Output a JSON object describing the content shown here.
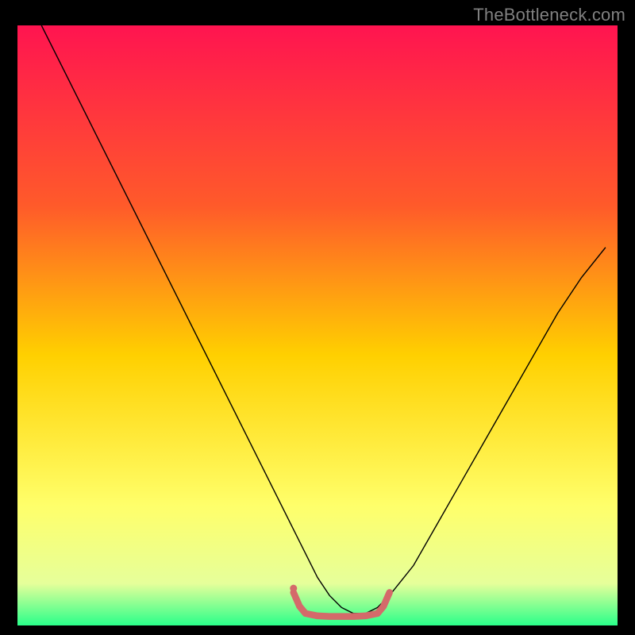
{
  "watermark": "TheBottleneck.com",
  "chart_data": {
    "type": "line",
    "title": "",
    "xlabel": "",
    "ylabel": "",
    "xlim": [
      0,
      100
    ],
    "ylim": [
      0,
      100
    ],
    "background_gradient": {
      "stops": [
        {
          "offset": 0.0,
          "color": "#ff1450"
        },
        {
          "offset": 0.3,
          "color": "#ff5a2a"
        },
        {
          "offset": 0.55,
          "color": "#ffd000"
        },
        {
          "offset": 0.8,
          "color": "#ffff6a"
        },
        {
          "offset": 0.93,
          "color": "#e6ff9a"
        },
        {
          "offset": 1.0,
          "color": "#2aff8a"
        }
      ]
    },
    "series": [
      {
        "name": "bottleneck-curve",
        "color": "#000000",
        "width": 1.4,
        "x": [
          4,
          8,
          12,
          16,
          20,
          24,
          28,
          32,
          36,
          40,
          44,
          46,
          48,
          50,
          52,
          54,
          56,
          58,
          60,
          62,
          66,
          70,
          74,
          78,
          82,
          86,
          90,
          94,
          98
        ],
        "y": [
          100,
          92,
          84,
          76,
          68,
          60,
          52,
          44,
          36,
          28,
          20,
          16,
          12,
          8,
          5,
          3,
          2,
          2,
          3,
          5,
          10,
          17,
          24,
          31,
          38,
          45,
          52,
          58,
          63
        ]
      },
      {
        "name": "optimal-range-marker",
        "color": "#d46a6a",
        "width": 8.5,
        "x": [
          46,
          47,
          48,
          50,
          52,
          54,
          56,
          58,
          60,
          61,
          62
        ],
        "y": [
          5.5,
          3.2,
          2.0,
          1.6,
          1.5,
          1.5,
          1.5,
          1.6,
          2.0,
          3.2,
          5.5
        ]
      }
    ],
    "annotations": [
      {
        "name": "optimal-range-start-dot",
        "shape": "circle",
        "x": 46,
        "y": 6.2,
        "r": 4.5,
        "color": "#d46a6a"
      }
    ]
  }
}
